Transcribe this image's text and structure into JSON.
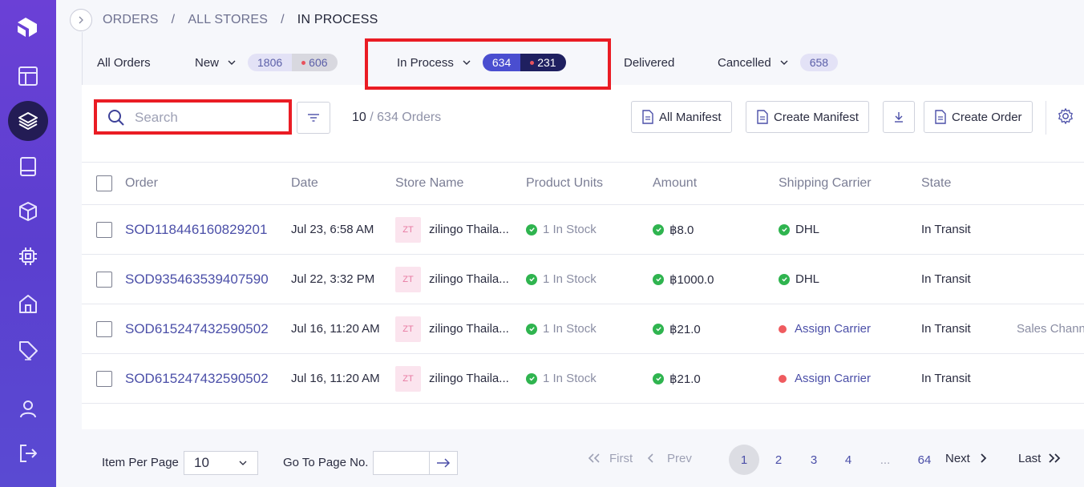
{
  "breadcrumb": {
    "root": "ORDERS",
    "middle": "ALL STORES",
    "current": "IN PROCESS"
  },
  "tabs": {
    "all": "All Orders",
    "new": {
      "label": "New",
      "count": "1806",
      "alert": "606"
    },
    "in_process": {
      "label": "In Process",
      "count": "634",
      "alert": "231"
    },
    "delivered": "Delivered",
    "cancelled": {
      "label": "Cancelled",
      "count": "658"
    }
  },
  "toolbar": {
    "search_placeholder": "Search",
    "shown": "10",
    "total": "/ 634 Orders",
    "all_manifest": "All Manifest",
    "create_manifest": "Create Manifest",
    "create_order": "Create Order"
  },
  "table": {
    "headers": {
      "order": "Order",
      "date": "Date",
      "store": "Store Name",
      "units": "Product Units",
      "amount": "Amount",
      "carrier": "Shipping Carrier",
      "state": "State"
    },
    "rows": [
      {
        "order": "SOD118446160829201",
        "date": "Jul 23, 6:58 AM",
        "store_badge": "ZT",
        "store": "zilingo Thaila...",
        "units": "1 In Stock",
        "amount": "฿8.0",
        "carrier": "DHL",
        "carrier_ok": true,
        "state": "In Transit",
        "extra": ""
      },
      {
        "order": "SOD935463539407590",
        "date": "Jul 22, 3:32 PM",
        "store_badge": "ZT",
        "store": "zilingo Thaila...",
        "units": "1 In Stock",
        "amount": "฿1000.0",
        "carrier": "DHL",
        "carrier_ok": true,
        "state": "In Transit",
        "extra": ""
      },
      {
        "order": "SOD615247432590502",
        "date": "Jul 16, 11:20 AM",
        "store_badge": "ZT",
        "store": "zilingo Thaila...",
        "units": "1 In Stock",
        "amount": "฿21.0",
        "carrier": "Assign Carrier",
        "carrier_ok": false,
        "state": "In Transit",
        "extra": "Sales Chann"
      },
      {
        "order": "SOD615247432590502",
        "date": "Jul 16, 11:20 AM",
        "store_badge": "ZT",
        "store": "zilingo Thaila...",
        "units": "1 In Stock",
        "amount": "฿21.0",
        "carrier": "Assign Carrier",
        "carrier_ok": false,
        "state": "In Transit",
        "extra": ""
      }
    ]
  },
  "footer": {
    "per_page_label": "Item Per Page",
    "per_page_value": "10",
    "goto_label": "Go To Page No.",
    "first": "First",
    "prev": "Prev",
    "pages": [
      "1",
      "2",
      "3",
      "4",
      "...",
      "64"
    ],
    "next": "Next",
    "last": "Last"
  },
  "colors": {
    "sidebar": "#5b3fcf",
    "accent": "#4b4fa8",
    "highlight": "#ea1c24"
  },
  "icons": [
    "logo-icon",
    "dashboard-icon",
    "layers-icon",
    "book-icon",
    "box-icon",
    "chip-icon",
    "home-icon",
    "tag-icon",
    "user-icon",
    "logout-icon",
    "search-icon",
    "filter-icon",
    "document-icon",
    "download-icon",
    "gear-icon"
  ]
}
